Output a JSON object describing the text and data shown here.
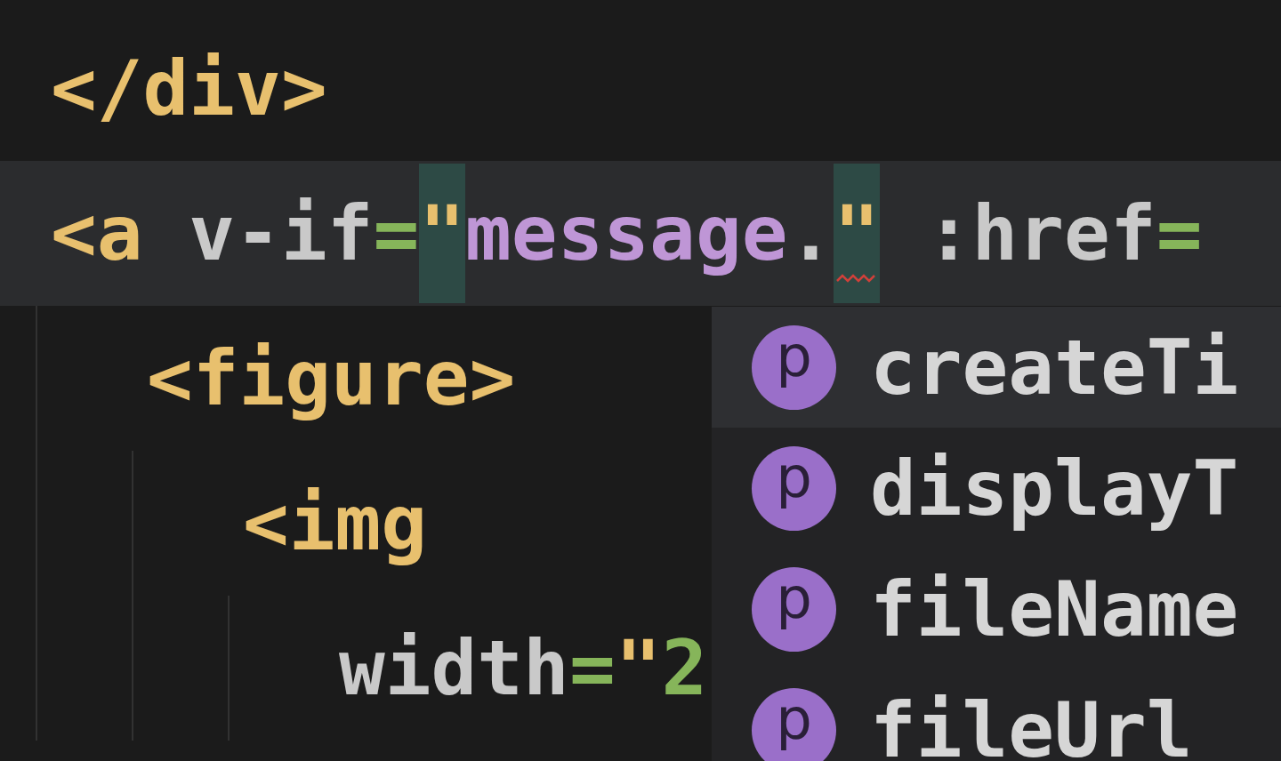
{
  "editor": {
    "lines": [
      {
        "selected": false,
        "tokens": [
          {
            "kind": "tag",
            "text": "</div>"
          }
        ]
      },
      {
        "selected": true,
        "tokens": [
          {
            "kind": "tag",
            "text": "<a"
          },
          {
            "kind": "attr",
            "text": " v-if"
          },
          {
            "kind": "eq",
            "text": "="
          },
          {
            "kind": "quote",
            "text": "\"",
            "matched": true,
            "error": false
          },
          {
            "kind": "value",
            "text": "message"
          },
          {
            "kind": "punct",
            "text": "."
          },
          {
            "kind": "quote",
            "text": "\"",
            "matched": true,
            "error": true
          },
          {
            "kind": "attr",
            "text": " :href"
          },
          {
            "kind": "eq",
            "text": "="
          }
        ],
        "children": [
          {
            "selected": false,
            "tokens": [
              {
                "kind": "tag",
                "text": "<figure>"
              }
            ],
            "children": [
              {
                "selected": false,
                "tokens": [
                  {
                    "kind": "tag",
                    "text": "<img"
                  }
                ],
                "children": [
                  {
                    "selected": false,
                    "tokens": [
                      {
                        "kind": "attr",
                        "text": "width"
                      },
                      {
                        "kind": "eq",
                        "text": "="
                      },
                      {
                        "kind": "quote",
                        "text": "\""
                      },
                      {
                        "kind": "number",
                        "text": "2"
                      }
                    ]
                  }
                ]
              }
            ]
          }
        ]
      }
    ]
  },
  "suggestions": {
    "items": [
      {
        "icon": "p",
        "label": "createTi",
        "selected": true
      },
      {
        "icon": "p",
        "label": "displayT",
        "selected": false
      },
      {
        "icon": "p",
        "label": "fileName",
        "selected": false
      },
      {
        "icon": "p",
        "label": "fileUrl",
        "selected": false
      }
    ]
  }
}
